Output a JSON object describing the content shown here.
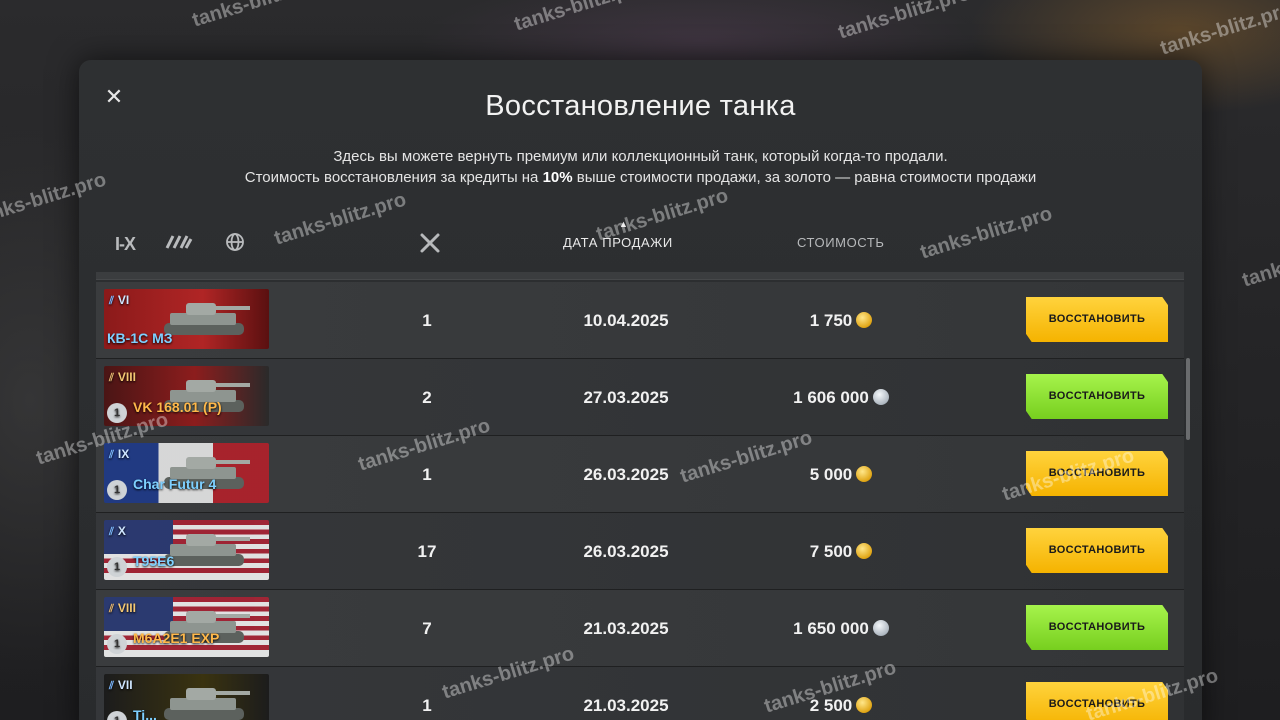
{
  "dialog": {
    "title": "Восстановление танка",
    "description_line1": "Здесь вы можете вернуть премиум или коллекционный танк, который когда-то продали.",
    "description_line2_before": "Стоимость восстановления за кредиты на ",
    "description_line2_bold": "10%",
    "description_line2_after": " выше стоимости продажи, за золото — равна стоимости продажи"
  },
  "filters": {
    "tier_label": "I-X",
    "class_icon": "tank-class-icon",
    "nation_icon": "globe-icon"
  },
  "columns": {
    "battles_icon": "crossed-swords-icon",
    "date": "ДАТА ПРОДАЖИ",
    "cost": "СТОИМОСТЬ"
  },
  "rows": [
    {
      "tier": "VI",
      "name": "КВ-1С МЗ",
      "premium": false,
      "mastery": "",
      "flag": "ussr",
      "battles": "1",
      "date": "10.04.2025",
      "cost": "1 750",
      "currency": "gold",
      "button": "ВОССТАНОВИТЬ"
    },
    {
      "tier": "VIII",
      "name": "VK 168.01 (P)",
      "premium": true,
      "mastery": "1",
      "flag": "germany",
      "battles": "2",
      "date": "27.03.2025",
      "cost": "1 606 000",
      "currency": "silver",
      "button": "ВОССТАНОВИТЬ"
    },
    {
      "tier": "IX",
      "name": "Char Futur 4",
      "premium": false,
      "mastery": "1",
      "flag": "france",
      "battles": "1",
      "date": "26.03.2025",
      "cost": "5 000",
      "currency": "gold",
      "button": "ВОССТАНОВИТЬ"
    },
    {
      "tier": "X",
      "name": "T95E6",
      "premium": false,
      "mastery": "1",
      "flag": "usa",
      "battles": "17",
      "date": "26.03.2025",
      "cost": "7 500",
      "currency": "gold",
      "button": "ВОССТАНОВИТЬ"
    },
    {
      "tier": "VIII",
      "name": "M6A2E1 EXP",
      "premium": true,
      "mastery": "1",
      "flag": "usa",
      "battles": "7",
      "date": "21.03.2025",
      "cost": "1 650 000",
      "currency": "silver",
      "button": "ВОССТАНОВИТЬ"
    },
    {
      "tier": "VII",
      "name": "Ti...",
      "premium": false,
      "mastery": "1",
      "flag": "other",
      "battles": "1",
      "date": "21.03.2025",
      "cost": "2 500",
      "currency": "gold",
      "button": "ВОССТАНОВИТЬ"
    }
  ],
  "watermark": "tanks-blitz.pro",
  "colors": {
    "gold_button": "#ffc61a",
    "green_button": "#8de336",
    "premium_name": "#ffb84a",
    "regular_name": "#7ed0ff"
  }
}
